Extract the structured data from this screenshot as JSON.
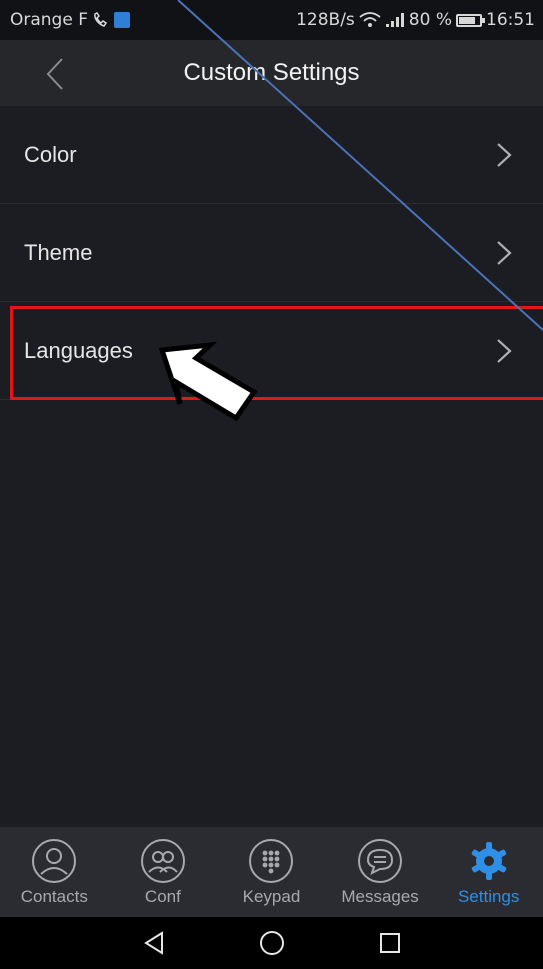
{
  "status_bar": {
    "carrier": "Orange F",
    "net_speed": "128B/s",
    "battery": "80 %",
    "battery_level": 0.8,
    "time": "16:51"
  },
  "header": {
    "title": "Custom Settings",
    "back_icon": "chevron-left-icon"
  },
  "menu": {
    "items": [
      {
        "label": "Color",
        "icon": "chevron-right-icon"
      },
      {
        "label": "Theme",
        "icon": "chevron-right-icon"
      },
      {
        "label": "Languages",
        "icon": "chevron-right-icon"
      }
    ]
  },
  "bottom_nav": {
    "tabs": [
      {
        "label": "Contacts",
        "icon": "contact-icon",
        "active": false
      },
      {
        "label": "Conf",
        "icon": "conference-icon",
        "active": false
      },
      {
        "label": "Keypad",
        "icon": "keypad-icon",
        "active": false
      },
      {
        "label": "Messages",
        "icon": "message-icon",
        "active": false
      },
      {
        "label": "Settings",
        "icon": "gear-icon",
        "active": true
      }
    ],
    "active_color": "#2d8fe6",
    "inactive_color": "#a8a8ad"
  },
  "colors": {
    "background": "#1c1d22",
    "header": "#26272b",
    "highlight": "#e01818",
    "annotation_line": "#4a72b8"
  }
}
